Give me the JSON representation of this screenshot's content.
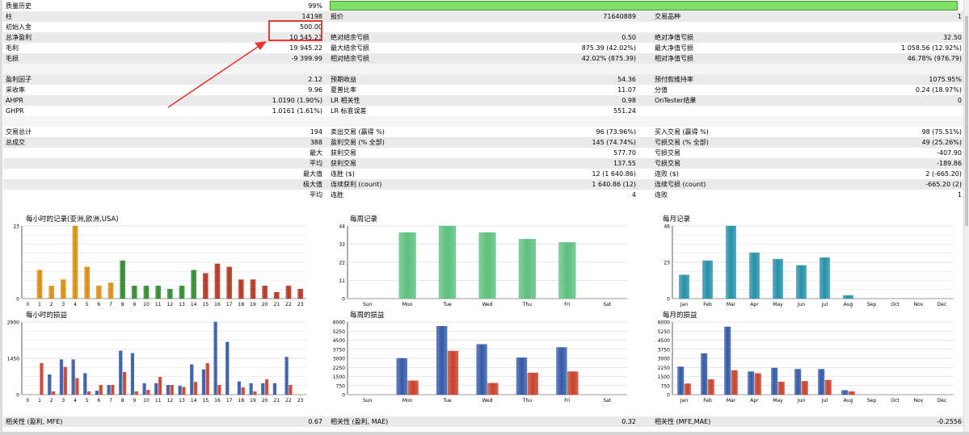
{
  "stats": {
    "top": [
      {
        "l1": "质量历史",
        "v1": "99%",
        "l2": "",
        "v2": "",
        "l3": "",
        "v3": ""
      },
      {
        "l1": "柱",
        "v1": "14198",
        "l2": "报价",
        "v2": "71640889",
        "l3": "交易品种",
        "v3": "1"
      },
      {
        "l1": "初始入金",
        "v1": "500.00",
        "l2": "",
        "v2": "",
        "l3": "",
        "v3": ""
      },
      {
        "l1": "总净盈利",
        "v1": "10 545.23",
        "l2": "绝对结余亏损",
        "v2": "0.50",
        "l3": "绝对净值亏损",
        "v3": "32.50"
      },
      {
        "l1": "毛利",
        "v1": "19 945.22",
        "l2": "最大结余亏损",
        "v2": "875.39 (42.02%)",
        "l3": "最大净值亏损",
        "v3": "1 058.56 (12.92%)"
      },
      {
        "l1": "毛损",
        "v1": "-9 399.99",
        "l2": "相对结余亏损",
        "v2": "42.02% (875.39)",
        "l3": "相对净值亏损",
        "v3": "46.78% (976.79)"
      }
    ],
    "mid": [
      {
        "l1": "盈利因子",
        "v1": "2.12",
        "l2": "预期收益",
        "v2": "54.36",
        "l3": "预付款维持率",
        "v3": "1075.95%"
      },
      {
        "l1": "采收率",
        "v1": "9.96",
        "l2": "夏普比率",
        "v2": "11.07",
        "l3": "分值",
        "v3": "0.24 (18.97%)"
      },
      {
        "l1": "AHPR",
        "v1": "1.0190 (1.90%)",
        "l2": "LR 相关性",
        "v2": "0.98",
        "l3": "OnTester结果",
        "v3": "0"
      },
      {
        "l1": "GHPR",
        "v1": "1.0161 (1.61%)",
        "l2": "LR 标准误差",
        "v2": "551.24",
        "l3": "",
        "v3": ""
      }
    ],
    "trades": [
      {
        "l1": "交易总计",
        "v1": "194",
        "l2": "卖出交易 (赢得 %)",
        "v2": "96 (73.96%)",
        "l3": "买入交易 (赢得 %)",
        "v3": "98 (75.51%)"
      },
      {
        "l1": "总成交",
        "v1": "388",
        "l2": "盈利交易 (% 全部)",
        "v2": "145 (74.74%)",
        "l3": "亏损交易 (% 全部)",
        "v3": "49 (25.26%)"
      },
      {
        "l1": "",
        "v1": "最大",
        "l2": "获利交易",
        "v2": "577.70",
        "l3": "亏损交易",
        "v3": "-407.90"
      },
      {
        "l1": "",
        "v1": "平均",
        "l2": "获利交易",
        "v2": "137.55",
        "l3": "亏损交易",
        "v3": "-189.86"
      },
      {
        "l1": "",
        "v1": "最大值",
        "l2": "连胜 ($)",
        "v2": "12 (1 640.86)",
        "l3": "连败 ($)",
        "v3": "2 (-665.20)"
      },
      {
        "l1": "",
        "v1": "极大值",
        "l2": "连续获利 (count)",
        "v2": "1 640.86 (12)",
        "l3": "连续亏损 (count)",
        "v3": "-665.20 (2)"
      },
      {
        "l1": "",
        "v1": "平均",
        "l2": "连胜",
        "v2": "4",
        "l3": "连败",
        "v3": "1"
      }
    ],
    "bottom": {
      "l1": "相关性 (盈利, MFE)",
      "v1": "0.67",
      "l2": "相关性 (盈利, MAE)",
      "v2": "0.32",
      "l3": "相关性 (MFE,MAE)",
      "v3": "-0.2556"
    }
  },
  "quality_progress": 0.99,
  "colors": {
    "orange": "#d98c10",
    "green": "#2d8a2d",
    "red": "#b3341f",
    "mint": "#5cbf7d",
    "teal": "#2590a8",
    "blue": "#3459a8",
    "salmon": "#c9402a"
  },
  "chart_data": [
    {
      "type": "bar",
      "title": "每小时的记录(亚洲,欧洲,USA)",
      "categories": [
        "0",
        "1",
        "2",
        "3",
        "4",
        "5",
        "6",
        "7",
        "8",
        "9",
        "10",
        "11",
        "12",
        "13",
        "14",
        "15",
        "16",
        "17",
        "18",
        "19",
        "20",
        "21",
        "22",
        "23"
      ],
      "values": [
        0,
        9,
        4,
        6,
        23,
        10,
        4,
        5,
        12,
        4,
        4,
        4,
        3,
        4,
        9,
        8,
        11,
        10,
        6,
        6,
        4,
        2,
        4,
        3
      ],
      "bar_colors": [
        "orange",
        "orange",
        "orange",
        "orange",
        "orange",
        "orange",
        "orange",
        "orange",
        "green",
        "green",
        "green",
        "green",
        "green",
        "green",
        "green",
        "red",
        "red",
        "red",
        "red",
        "red",
        "red",
        "red",
        "red",
        "red"
      ],
      "yticks": [
        "0",
        "23"
      ],
      "ylim": [
        0,
        23
      ]
    },
    {
      "type": "bar",
      "title": "每周记录",
      "categories": [
        "Sun",
        "Mon",
        "Tue",
        "Wed",
        "Thu",
        "Fri",
        "Sat"
      ],
      "values": [
        0,
        40,
        44,
        40,
        36,
        34,
        0
      ],
      "bar_colors": [
        "mint",
        "mint",
        "mint",
        "mint",
        "mint",
        "mint",
        "mint"
      ],
      "yticks": [
        "0",
        "11",
        "22",
        "33",
        "44"
      ],
      "ylim": [
        0,
        44
      ]
    },
    {
      "type": "bar",
      "title": "每月记录",
      "categories": [
        "Jan",
        "Feb",
        "Mar",
        "Apr",
        "May",
        "Jun",
        "Jul",
        "Aug",
        "Sep",
        "Oct",
        "Nov",
        "Dec"
      ],
      "values": [
        15,
        24,
        46,
        29,
        25,
        21,
        26,
        2,
        0,
        0,
        0,
        0
      ],
      "bar_colors": [
        "teal",
        "teal",
        "teal",
        "teal",
        "teal",
        "teal",
        "teal",
        "teal",
        "teal",
        "teal",
        "teal",
        "teal"
      ],
      "yticks": [
        "0",
        "23",
        "46"
      ],
      "ylim": [
        0,
        46
      ]
    },
    {
      "type": "bar",
      "title": "每小时的损益",
      "categories": [
        "0",
        "1",
        "2",
        "3",
        "4",
        "5",
        "6",
        "7",
        "8",
        "9",
        "10",
        "11",
        "12",
        "13",
        "14",
        "15",
        "16",
        "17",
        "18",
        "19",
        "20",
        "21",
        "22",
        "23"
      ],
      "series": [
        {
          "values": [
            0,
            0,
            800,
            1400,
            1400,
            850,
            150,
            380,
            1750,
            1650,
            450,
            450,
            380,
            350,
            1200,
            1000,
            2900,
            2100,
            520,
            450,
            450,
            450,
            1500,
            0
          ]
        },
        {
          "values": [
            0,
            1250,
            120,
            1100,
            650,
            120,
            380,
            380,
            900,
            120,
            180,
            700,
            380,
            300,
            500,
            1250,
            380,
            0,
            280,
            120,
            600,
            0,
            380,
            0
          ]
        }
      ],
      "yticks": [
        "0",
        "1450",
        "2900"
      ],
      "ylim": [
        0,
        2900
      ]
    },
    {
      "type": "bar",
      "title": "每周的损益",
      "categories": [
        "Sun",
        "Mon",
        "Tue",
        "Wed",
        "Thu",
        "Fri",
        "Sat"
      ],
      "series": [
        {
          "values": [
            0,
            3000,
            5650,
            4150,
            3050,
            3900,
            0
          ]
        },
        {
          "values": [
            0,
            1150,
            3600,
            950,
            1800,
            1900,
            0
          ]
        }
      ],
      "yticks": [
        "0",
        "750",
        "1500",
        "2250",
        "3000",
        "3750",
        "4500",
        "5250",
        "6000"
      ],
      "ylim": [
        0,
        6000
      ]
    },
    {
      "type": "bar",
      "title": "每月的损益",
      "categories": [
        "Jan",
        "Feb",
        "Mar",
        "Apr",
        "May",
        "Jun",
        "Jul",
        "Aug",
        "Sep",
        "Oct",
        "Nov",
        "Dec"
      ],
      "series": [
        {
          "values": [
            2300,
            3400,
            5600,
            1900,
            2200,
            2100,
            2100,
            350,
            0,
            0,
            0,
            0
          ]
        },
        {
          "values": [
            900,
            1250,
            2000,
            1750,
            1050,
            1100,
            1200,
            250,
            0,
            0,
            0,
            0
          ]
        }
      ],
      "yticks": [
        "0",
        "750",
        "1500",
        "2250",
        "3000",
        "3750",
        "4500",
        "5250",
        "6000"
      ],
      "ylim": [
        0,
        6000
      ]
    }
  ]
}
